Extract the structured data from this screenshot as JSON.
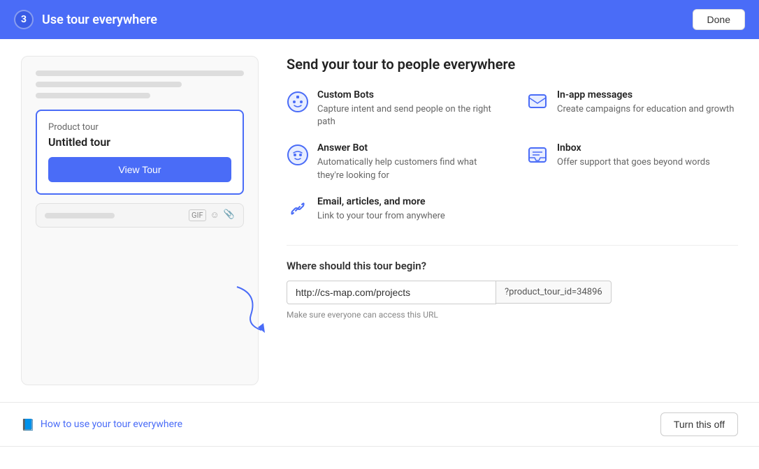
{
  "header": {
    "step_number": "3",
    "title": "Use tour everywhere",
    "done_label": "Done"
  },
  "preview": {
    "tour_type": "Product tour",
    "tour_name": "Untitled tour",
    "view_tour_label": "View Tour"
  },
  "options": {
    "section_title": "Send your tour to people everywhere",
    "items": [
      {
        "name": "Custom Bots",
        "description": "Capture intent and send people on the right path",
        "icon": "bot"
      },
      {
        "name": "In-app messages",
        "description": "Create campaigns for education and growth",
        "icon": "message"
      },
      {
        "name": "Answer Bot",
        "description": "Automatically help customers find what they're looking for",
        "icon": "bot2"
      },
      {
        "name": "Inbox",
        "description": "Offer support that goes beyond words",
        "icon": "inbox"
      },
      {
        "name": "Email, articles, and more",
        "description": "Link to your tour from anywhere",
        "icon": "link"
      }
    ]
  },
  "tour_begin": {
    "title": "Where should this tour begin?",
    "url_value": "http://cs-map.com/projects",
    "url_suffix": "?product_tour_id=34896",
    "hint": "Make sure everyone can access this URL"
  },
  "footer": {
    "help_label": "How to use your tour everywhere",
    "turn_off_label": "Turn this off"
  }
}
